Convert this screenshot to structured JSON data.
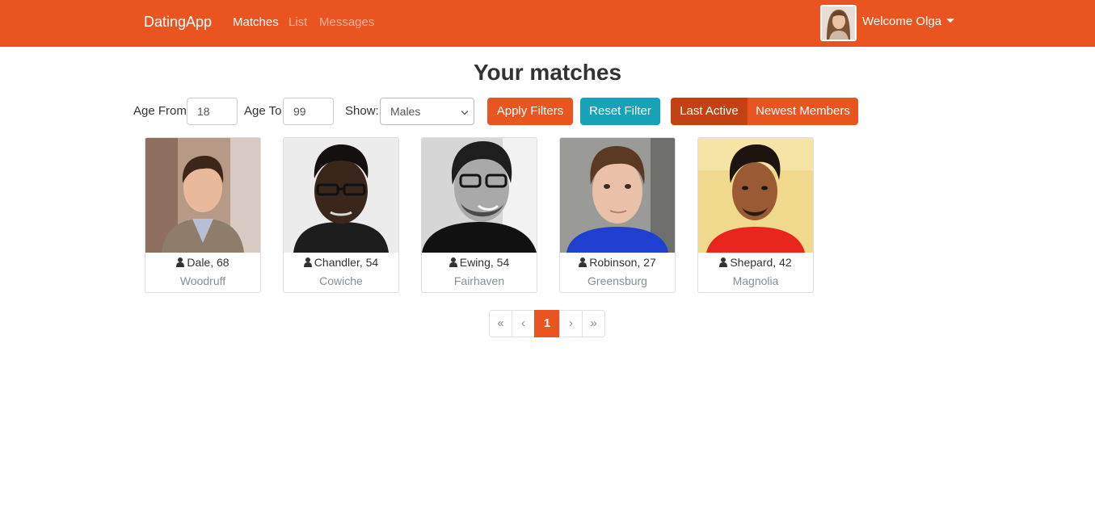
{
  "navbar": {
    "brand": "DatingApp",
    "links": [
      "Matches",
      "List",
      "Messages"
    ],
    "welcome": "Welcome Olga"
  },
  "page_title": "Your matches",
  "filters": {
    "age_from_label": "Age From",
    "age_from_value": "18",
    "age_to_label": "Age To",
    "age_to_value": "99",
    "show_label": "Show:",
    "show_selected": "Males",
    "apply_label": "Apply Filters",
    "reset_label": "Reset Filter",
    "sort_options": [
      "Last Active",
      "Newest Members"
    ]
  },
  "members": [
    {
      "name_age": "Dale, 68",
      "city": "Woodruff"
    },
    {
      "name_age": "Chandler, 54",
      "city": "Cowiche"
    },
    {
      "name_age": "Ewing, 54",
      "city": "Fairhaven"
    },
    {
      "name_age": "Robinson, 27",
      "city": "Greensburg"
    },
    {
      "name_age": "Shepard, 42",
      "city": "Magnolia"
    }
  ],
  "pagination": {
    "first": "«",
    "prev": "‹",
    "current": "1",
    "next": "›",
    "last": "»"
  },
  "colors": {
    "primary": "#e95420",
    "primary_dark": "#c34113",
    "info": "#17a2b8"
  }
}
